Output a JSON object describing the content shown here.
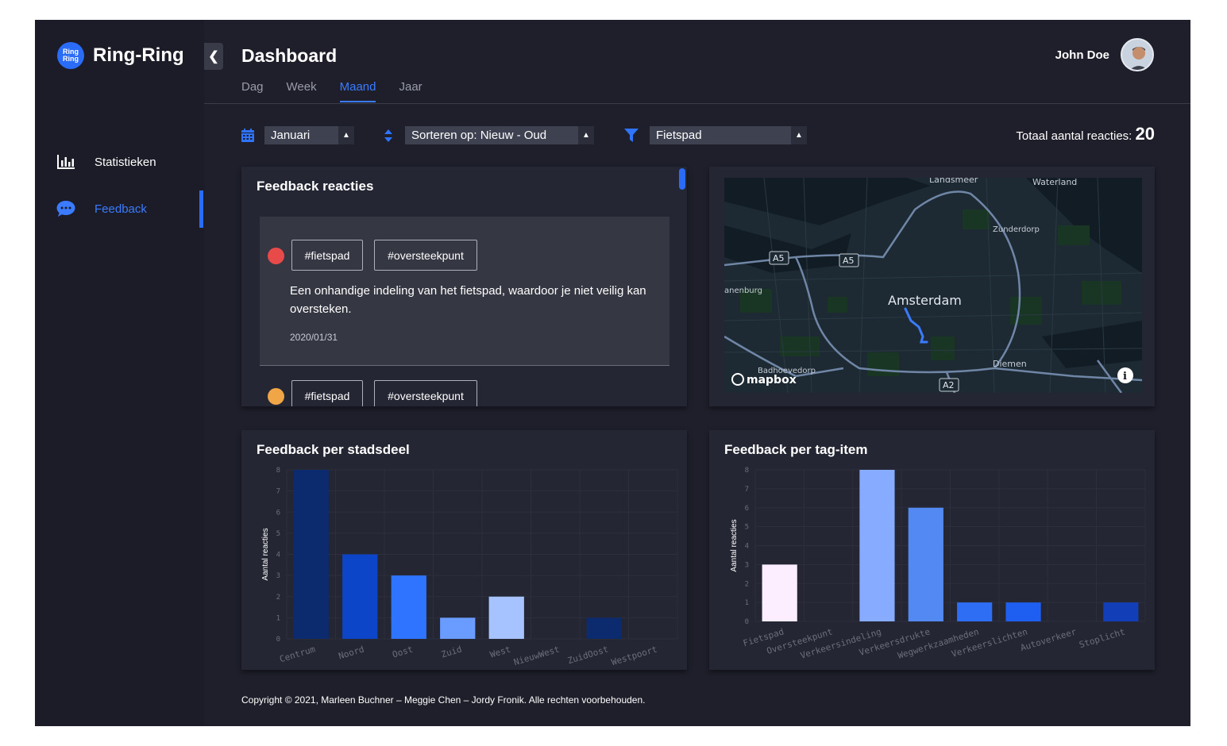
{
  "brand": {
    "name": "Ring-Ring",
    "logo_text_1": "Ring",
    "logo_text_2": "Ring"
  },
  "sidebar": {
    "items": [
      {
        "label": "Statistieken",
        "icon": "bar-chart-icon",
        "active": false
      },
      {
        "label": "Feedback",
        "icon": "chat-bubble-icon",
        "active": true
      }
    ]
  },
  "header": {
    "title": "Dashboard",
    "tabs": [
      {
        "label": "Dag"
      },
      {
        "label": "Week"
      },
      {
        "label": "Maand"
      },
      {
        "label": "Jaar"
      }
    ],
    "active_tab": "Maand",
    "user_name": "John Doe"
  },
  "filters": {
    "month": "Januari",
    "sort": "Sorteren op: Nieuw - Oud",
    "category": "Fietspad",
    "total_label": "Totaal aantal reacties:",
    "total_value": "20"
  },
  "feedback": {
    "title": "Feedback reacties",
    "items": [
      {
        "color": "#e84a4a",
        "tags": [
          "#fietspad",
          "#oversteekpunt"
        ],
        "text": "Een onhandige indeling van het fietspad, waardoor je niet veilig kan oversteken.",
        "date": "2020/01/31"
      },
      {
        "color": "#f0a647",
        "tags": [
          "#fietspad",
          "#oversteekpunt"
        ],
        "text": "",
        "date": ""
      }
    ]
  },
  "map": {
    "labels": {
      "landsmeer": "Landsmeer",
      "waterland": "Waterland",
      "zunderdorp": "Zunderdorp",
      "a5_1": "A5",
      "a5_2": "A5",
      "anenburg": "anenburg",
      "amsterdam": "Amsterdam",
      "badhoevedorp": "Badhoevedorp",
      "diemen": "Diemen",
      "a2": "A2",
      "mapbox": "mapbox"
    }
  },
  "charts": {
    "chart_data": [
      {
        "type": "bar",
        "title": "Feedback per stadsdeel",
        "ylabel": "Aantal reacties",
        "xlabel": "",
        "categories": [
          "Centrum",
          "Noord",
          "Oost",
          "Zuid",
          "West",
          "NieuwWest",
          "ZuidOost",
          "Westpoort"
        ],
        "values": [
          8,
          4,
          3,
          1,
          2,
          0,
          1,
          0
        ],
        "colors": [
          "#0c2a6e",
          "#0d45c9",
          "#2e74ff",
          "#6a9bff",
          "#a6c2ff",
          "#6a9bff",
          "#0c2a6e",
          "#0c2a6e"
        ],
        "ylim": [
          0,
          8
        ],
        "grid": true
      },
      {
        "type": "bar",
        "title": "Feedback per tag-item",
        "ylabel": "Aantal reacties",
        "xlabel": "",
        "categories": [
          "Fietspad",
          "Oversteekpunt",
          "Verkeersindeling",
          "Verkeersdrukte",
          "Wegwerkzaamheden",
          "Verkeerslichten",
          "Autoverkeer",
          "Stoplicht"
        ],
        "values": [
          3,
          0,
          8,
          6,
          1,
          1,
          0,
          1
        ],
        "colors": [
          "#fdeeff",
          "#fdeeff",
          "#86abff",
          "#5389f2",
          "#2e6ef5",
          "#1e5ef0",
          "#1e5ef0",
          "#123fb8"
        ],
        "ylim": [
          0,
          8
        ],
        "grid": true
      }
    ]
  },
  "footer": {
    "text": "Copyright © 2021, Marleen Buchner – Meggie Chen – Jordy Fronik. Alle rechten voorbehouden."
  }
}
